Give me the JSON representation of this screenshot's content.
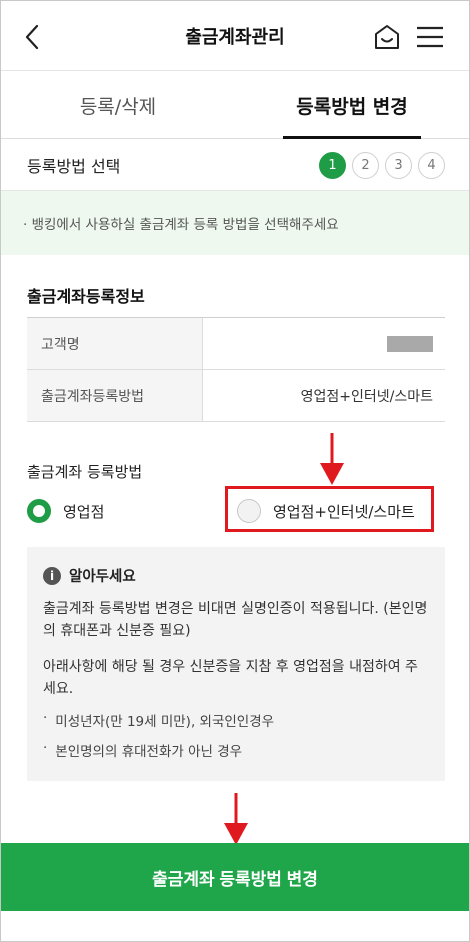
{
  "header": {
    "title": "출금계좌관리"
  },
  "tabs": [
    {
      "label": "등록/삭제",
      "active": false
    },
    {
      "label": "등록방법 변경",
      "active": true
    }
  ],
  "steps": {
    "label": "등록방법 선택",
    "items": [
      "1",
      "2",
      "3",
      "4"
    ],
    "current": 1
  },
  "notice": {
    "text": "· 뱅킹에서 사용하실 출금계좌 등록 방법을 선택해주세요"
  },
  "info": {
    "title": "출금계좌등록정보",
    "rows": [
      {
        "label": "고객명",
        "value": ""
      },
      {
        "label": "출금계좌등록방법",
        "value": "영업점+인터넷/스마트"
      }
    ]
  },
  "method": {
    "label": "출금계좌 등록방법",
    "options": [
      {
        "label": "영업점",
        "checked": true
      },
      {
        "label": "영업점+인터넷/스마트",
        "checked": false
      }
    ]
  },
  "notes": {
    "title": "알아두세요",
    "paragraph1": "출금계좌 등록방법 변경은 비대면 실명인증이 적용됩니다. (본인명의 휴대폰과 신분증 필요)",
    "paragraph2": "아래사항에 해당 될 경우 신분증을 지참 후 영업점을 내점하여 주세요.",
    "bullets": [
      "미성년자(만 19세 미만), 외국인인경우",
      "본인명의의 휴대전화가 아닌 경우"
    ]
  },
  "cta": {
    "label": "출금계좌 등록방법 변경"
  },
  "colors": {
    "accent": "#1fa64a",
    "highlight": "#e0191f"
  }
}
